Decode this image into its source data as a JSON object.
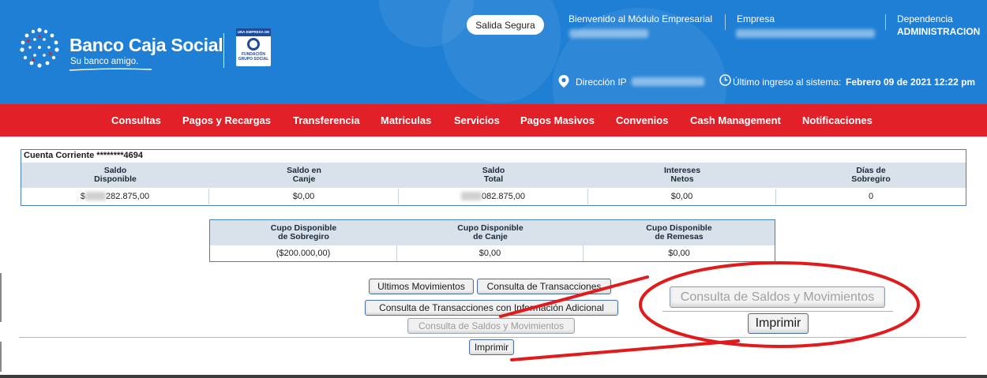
{
  "header": {
    "brand_name": "Banco Caja Social",
    "brand_tagline": "Su banco amigo.",
    "fundacion_top": "UNA EMPRESA DE",
    "fundacion_text": "FUNDACIÓN GRUPO SOCIAL",
    "safe_exit_label": "Salida Segura",
    "welcome_label": "Bienvenido al Módulo Empresarial",
    "company_label": "Empresa",
    "dependency_label": "Dependencia",
    "dependency_value": "ADMINISTRACION",
    "ip_label": "Dirección IP",
    "last_login_label": "Último ingreso al sistema:",
    "last_login_value": "Febrero 09 de 2021 12:22 pm",
    "colors": {
      "header_bg": "#1f7fd4",
      "nav_bg": "#e32028"
    }
  },
  "nav": {
    "items": [
      "Consultas",
      "Pagos y Recargas",
      "Transferencia",
      "Matriculas",
      "Servicios",
      "Pagos Masivos",
      "Convenios",
      "Cash Management",
      "Notificaciones"
    ]
  },
  "account": {
    "title": "Cuenta Corriente ********4694",
    "headers": [
      [
        "Saldo",
        "Disponible"
      ],
      [
        "Saldo en",
        "Canje"
      ],
      [
        "Saldo",
        "Total"
      ],
      [
        "Intereses",
        "Netos"
      ],
      [
        "Días de",
        "Sobregiro"
      ]
    ],
    "values": [
      "$",
      "$0,00",
      "",
      "$0,00",
      "0"
    ],
    "value_suffixes": [
      "282.875,00",
      "",
      "082.875,00",
      "",
      ""
    ]
  },
  "cupos": {
    "headers": [
      [
        "Cupo Disponible",
        "de Sobregiro"
      ],
      [
        "Cupo Disponible",
        "de Canje"
      ],
      [
        "Cupo Disponible",
        "de Remesas"
      ]
    ],
    "values": [
      "($200.000,00)",
      "$0,00",
      "$0,00"
    ]
  },
  "actions": {
    "ultimos_movimientos": "Ultimos Movimientos",
    "consulta_transacciones": "Consulta de Transacciones",
    "consulta_info_adicional": "Consulta de Transacciones con Información Adicional",
    "consulta_saldos": "Consulta de Saldos y Movimientos",
    "imprimir": "Imprimir"
  },
  "zoom": {
    "consulta_saldos": "Consulta de Saldos y Movimientos",
    "imprimir": "Imprimir",
    "annotation_color": "#e11b1b"
  }
}
